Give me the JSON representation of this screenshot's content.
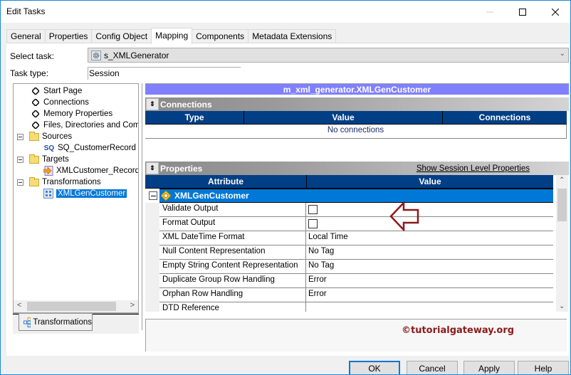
{
  "window": {
    "title": "Edit Tasks",
    "controls": {
      "minimize": "minimize",
      "maximize": "maximize",
      "close": "close"
    }
  },
  "tabs": [
    {
      "label": "General",
      "active": false
    },
    {
      "label": "Properties",
      "active": false
    },
    {
      "label": "Config Object",
      "active": false
    },
    {
      "label": "Mapping",
      "active": true
    },
    {
      "label": "Components",
      "active": false
    },
    {
      "label": "Metadata Extensions",
      "active": false
    }
  ],
  "form": {
    "select_task_label": "Select task:",
    "select_task_value": "s_XMLGenerator",
    "task_type_label": "Task type:",
    "task_type_value": "Session"
  },
  "tree": {
    "items": [
      {
        "label": "Start Page",
        "icon": "diamond-icon"
      },
      {
        "label": "Connections",
        "icon": "diamond-icon"
      },
      {
        "label": "Memory Properties",
        "icon": "diamond-icon"
      },
      {
        "label": "Files, Directories and Commands",
        "icon": "diamond-icon"
      },
      {
        "label": "Sources",
        "icon": "folder-icon",
        "expanded": true
      },
      {
        "label": "SQ_CustomerRecord",
        "icon": "source-qualifier-icon"
      },
      {
        "label": "Targets",
        "icon": "folder-icon",
        "expanded": true
      },
      {
        "label": "XMLCustomer_Records",
        "icon": "target-icon"
      },
      {
        "label": "Transformations",
        "icon": "folder-icon",
        "expanded": true
      },
      {
        "label": "XMLGenCustomer",
        "icon": "xml-generator-icon",
        "selected": true
      }
    ],
    "sq_icon_text": "SQ",
    "bottom_tab": "Transformations"
  },
  "mapping": {
    "header": "m_xml_generator.XMLGenCustomer",
    "connections": {
      "title": "Connections",
      "columns": [
        "Type",
        "Value",
        "Connections"
      ],
      "empty_text": "No connections"
    },
    "properties": {
      "title": "Properties",
      "link": "Show Session Level Properties",
      "columns": [
        "Attribute",
        "Value"
      ],
      "group": "XMLGenCustomer",
      "rows": [
        {
          "attribute": "Validate Output",
          "type": "checkbox",
          "checked": false,
          "value": ""
        },
        {
          "attribute": "Format Output",
          "type": "checkbox",
          "checked": false,
          "value": ""
        },
        {
          "attribute": "XML DateTime Format",
          "type": "text",
          "value": "Local Time"
        },
        {
          "attribute": "Null Content Representation",
          "type": "text",
          "value": "No Tag"
        },
        {
          "attribute": "Empty String Content Representation",
          "type": "text",
          "value": "No Tag"
        },
        {
          "attribute": "Duplicate Group Row Handling",
          "type": "text",
          "value": "Error"
        },
        {
          "attribute": "Orphan Row Handling",
          "type": "text",
          "value": "Error"
        },
        {
          "attribute": "DTD Reference",
          "type": "text",
          "value": ""
        }
      ]
    }
  },
  "watermark": "©tutorialgateway.org",
  "annotation": {
    "color": "#8b1a1a",
    "shape": "left-arrow"
  },
  "buttons": {
    "ok": "OK",
    "cancel": "Cancel",
    "apply": "Apply",
    "help": "Help"
  },
  "colors": {
    "header_purple": "#8080ff",
    "grid_header": "#003f86",
    "selection": "#0078d7",
    "watermark": "#8b1a1a"
  }
}
